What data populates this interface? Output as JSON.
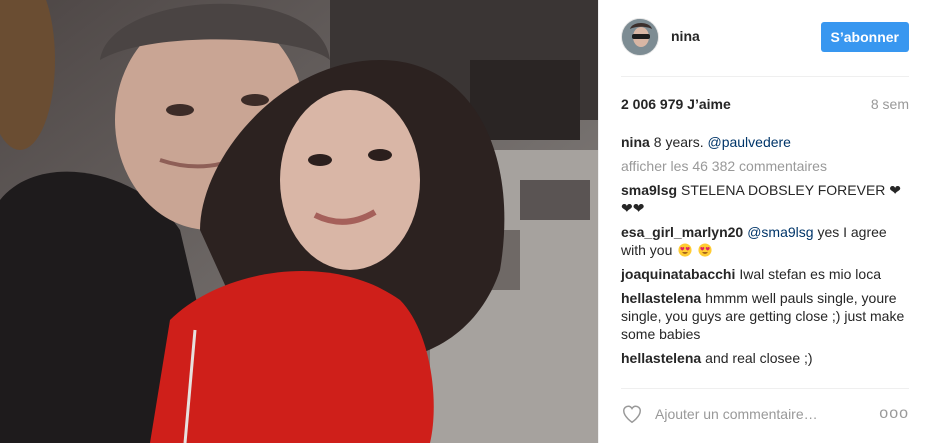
{
  "post": {
    "username": "nina",
    "follow_label": "S’abonner",
    "likes": "2 006 979 J’aime",
    "time": "8 sem",
    "caption_user": "nina",
    "caption_text": "8 years.",
    "caption_mention": "@paulvedere",
    "view_all": "afficher les 46 382 commentaires",
    "add_comment_placeholder": "Ajouter un commentaire…",
    "more_label": "ooo"
  },
  "comments": [
    {
      "user": "sma9lsg",
      "text": "STELENA DOBSLEY FOREVER ❤❤❤"
    },
    {
      "user": "esa_girl_marlyn20",
      "mention": "@sma9lsg",
      "text": "yes I agree with you"
    },
    {
      "user": "joaquinatabacchi",
      "text": "Iwal stefan es mio loca"
    },
    {
      "user": "hellastelena",
      "text": "hmmm well pauls single, youre single, you guys are getting close ;) just make some babies"
    },
    {
      "user": "hellastelena",
      "text": "and real closee ;)"
    }
  ],
  "icons": {
    "heart": "heart-icon",
    "emoji": "heart-eyes-emoji-icon",
    "more": "more-options-icon"
  },
  "colors": {
    "accent": "#3897f0",
    "mention": "#003569",
    "muted": "#999999"
  }
}
